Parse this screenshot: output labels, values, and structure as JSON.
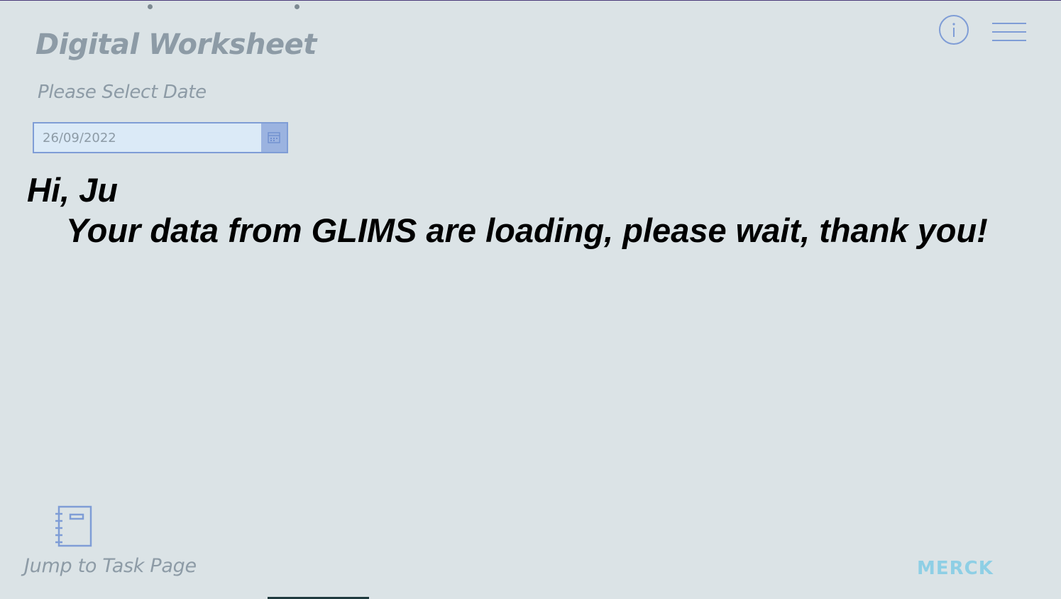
{
  "header": {
    "title": "Digital Worksheet",
    "date_prompt": "Please Select Date"
  },
  "date_picker": {
    "value": "26/09/2022"
  },
  "messages": {
    "greeting": "Hi, Ju",
    "loading": "Your data from GLIMS are loading, please wait, thank you!"
  },
  "footer": {
    "task_link_label": "Jump to Task Page",
    "logo_text": "MERCK"
  },
  "icons": {
    "info": "info-icon",
    "menu": "hamburger-menu-icon",
    "calendar": "calendar-icon",
    "task": "notebook-icon"
  },
  "colors": {
    "background": "#dbe3e6",
    "muted_text": "#8d9ba6",
    "accent_blue": "#7f9dd6",
    "logo": "#8ecfe5"
  }
}
